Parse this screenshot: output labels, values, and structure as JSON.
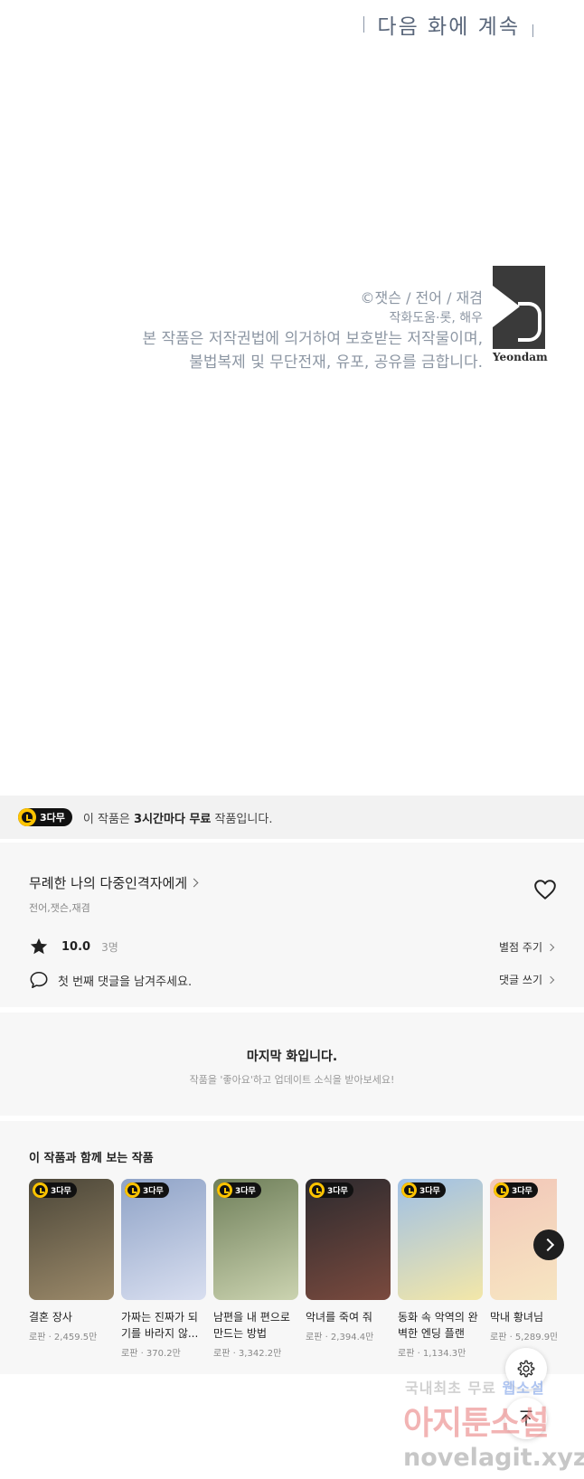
{
  "next_episode": {
    "label": "다음 화에 계속"
  },
  "copyright": {
    "line1": "©잿슨 / 전어 / 재겸",
    "line2": "작화도움·롯, 해우",
    "line3": "본 작품은 저작권법에 의거하여 보호받는 저작물이며,",
    "line4": "불법복제 및 무단전재, 유포, 공유를 금합니다.",
    "logo_text": "Yeondam"
  },
  "free_banner": {
    "badge": "3다무",
    "prefix": "이 작품은",
    "highlight": "3시간마다 무료",
    "suffix": "작품입니다."
  },
  "work": {
    "title": "무례한 나의 다중인격자에게",
    "authors": "전어,잿슨,재겸",
    "rating": "10.0",
    "rating_count": "3명",
    "rate_link": "별점 주기",
    "comment_prompt": "첫 번째 댓글을 남겨주세요.",
    "comment_link": "댓글 쓰기"
  },
  "last_episode": {
    "title": "마지막 화입니다.",
    "subtitle": "작품을 '좋아요'하고 업데이트 소식을 받아보세요!"
  },
  "recommendations": {
    "heading": "이 작품과 함께 보는 작품",
    "items": [
      {
        "badge": "3다무",
        "title": "결혼 장사",
        "meta": "로판 · 2,459.5만",
        "c1": "#4b4638",
        "c2": "#9c8a6a"
      },
      {
        "badge": "3다무",
        "title": "가짜는 진짜가 되기를 바라지 않...",
        "meta": "로판 · 370.2만",
        "c1": "#8fa3c7",
        "c2": "#d9dff0"
      },
      {
        "badge": "3다무",
        "title": "남편을 내 편으로 만드는 방법",
        "meta": "로판 · 3,342.2만",
        "c1": "#6f7f5a",
        "c2": "#cbd3b0"
      },
      {
        "badge": "3다무",
        "title": "악녀를 죽여 줘",
        "meta": "로판 · 2,394.4만",
        "c1": "#2c2a2e",
        "c2": "#7a4a3e"
      },
      {
        "badge": "3다무",
        "title": "동화 속 악역의 완벽한 엔딩 플랜",
        "meta": "로판 · 1,134.3만",
        "c1": "#9fc0e6",
        "c2": "#f3e7a8"
      },
      {
        "badge": "3다무",
        "title": "막내 황녀님",
        "meta": "로판 · 5,289.9만",
        "c1": "#f2c7b9",
        "c2": "#f7e7c2"
      }
    ]
  },
  "watermark": {
    "line1_a": "국내최초 무료",
    "line1_b": "웹소설",
    "line2": "아지툰소설",
    "line3": "novelagit.xyz"
  }
}
